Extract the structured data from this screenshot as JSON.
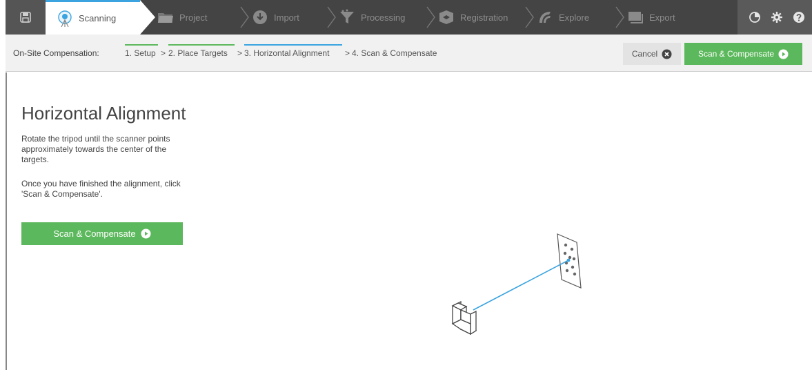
{
  "nav": {
    "tabs": [
      {
        "label": "Scanning",
        "icon": "scanner-icon",
        "active": true
      },
      {
        "label": "Project",
        "icon": "folder-icon",
        "active": false
      },
      {
        "label": "Import",
        "icon": "import-icon",
        "active": false
      },
      {
        "label": "Processing",
        "icon": "processing-icon",
        "active": false
      },
      {
        "label": "Registration",
        "icon": "registration-icon",
        "active": false
      },
      {
        "label": "Explore",
        "icon": "explore-icon",
        "active": false
      },
      {
        "label": "Export",
        "icon": "export-icon",
        "active": false
      }
    ],
    "tools": [
      "pie-chart-icon",
      "gear-icon",
      "help-icon"
    ]
  },
  "wizard": {
    "title": "On-Site Compensation:",
    "steps": [
      {
        "label": "1. Setup",
        "state": "done"
      },
      {
        "label": "2. Place Targets",
        "state": "done"
      },
      {
        "label": "3. Horizontal Alignment",
        "state": "current"
      },
      {
        "label": "4. Scan & Compensate",
        "state": "pending"
      }
    ],
    "separator": ">",
    "cancel_label": "Cancel",
    "scan_label": "Scan & Compensate"
  },
  "main": {
    "heading": "Horizontal Alignment",
    "instruction_1": "Rotate the tripod until the scanner points approximately towards the center of the targets.",
    "instruction_2": "Once you have finished the alignment, click 'Scan & Compensate'.",
    "scan_button_label": "Scan & Compensate"
  },
  "colors": {
    "topbar": "#444444",
    "active_tab_accent": "#3ba4e0",
    "done_step": "#5cb85c",
    "primary_button": "#5cb85c",
    "laser_line": "#3ba4e0"
  }
}
